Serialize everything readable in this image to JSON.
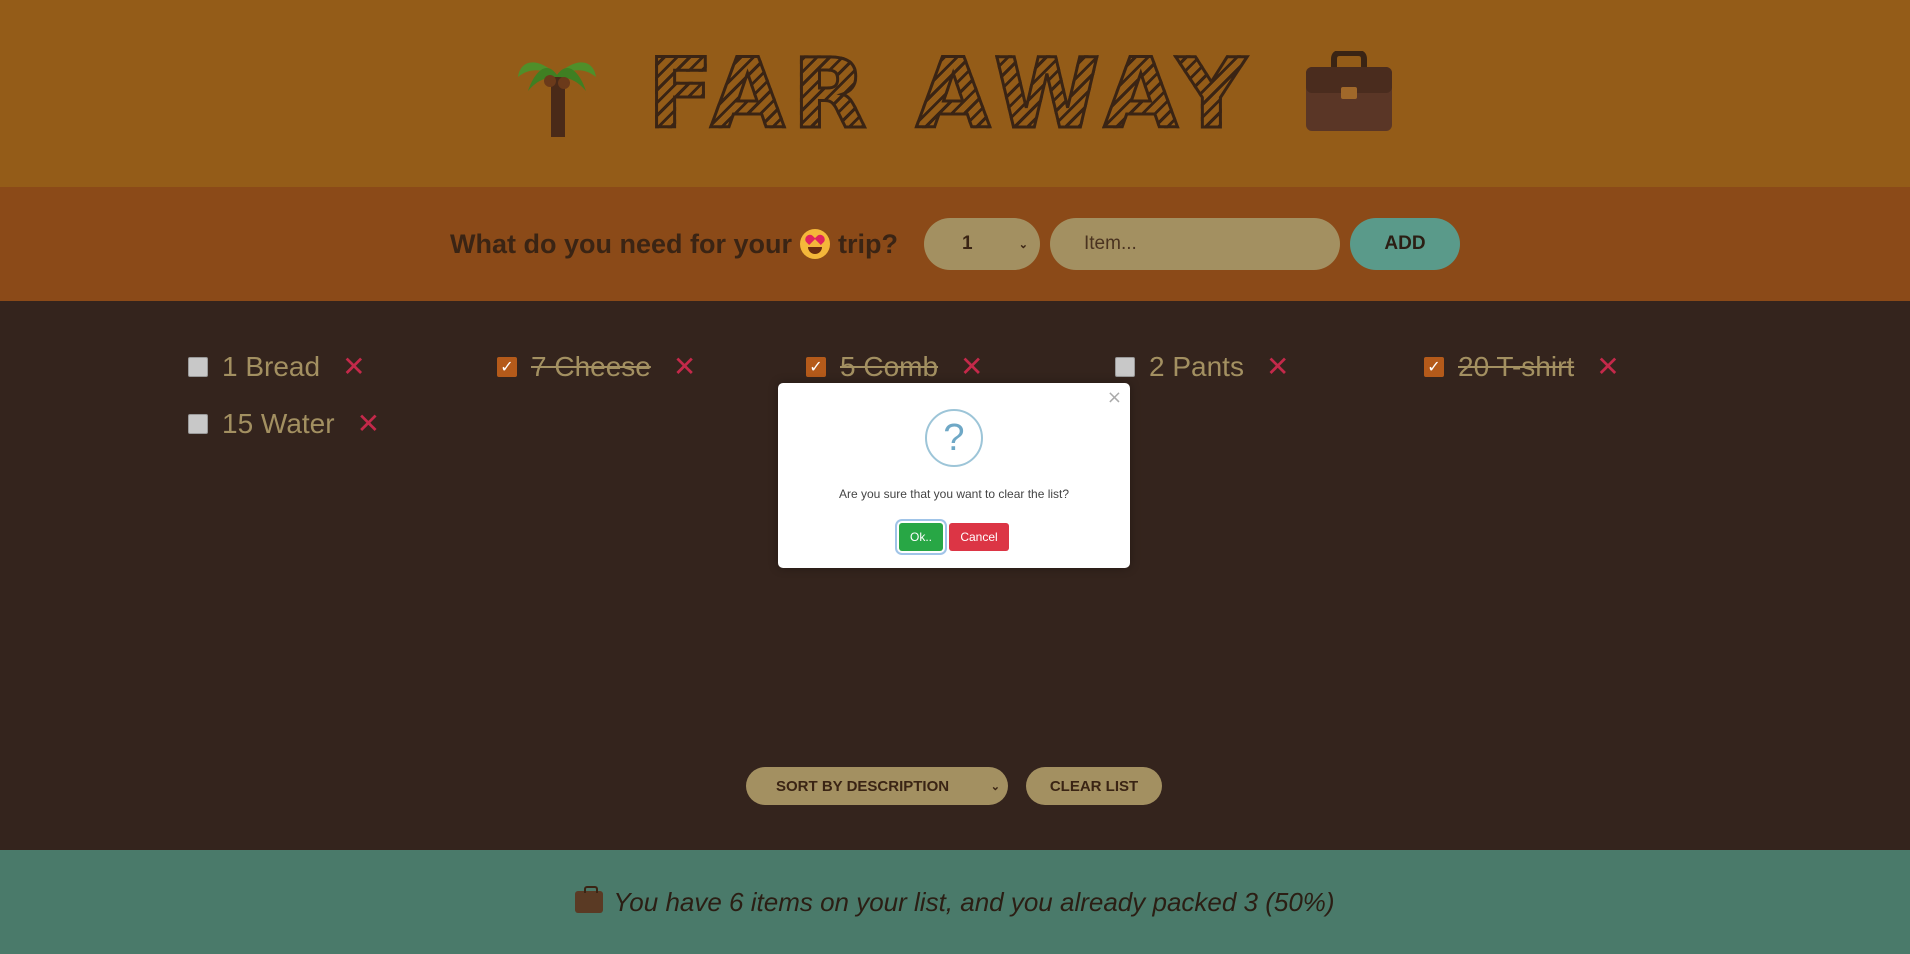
{
  "header": {
    "title": "FAR AWAY",
    "left_icon": "palm-tree-icon",
    "right_icon": "suitcase-icon"
  },
  "form": {
    "question_prefix": "What do you need for your",
    "question_emoji": "heart-eyes-emoji-icon",
    "question_suffix": "trip?",
    "quantity_value": "1",
    "item_placeholder": "Item...",
    "add_label": "ADD"
  },
  "items": [
    {
      "label": "1 Bread",
      "packed": false
    },
    {
      "label": "7 Cheese",
      "packed": true
    },
    {
      "label": "5 Comb",
      "packed": true
    },
    {
      "label": "2 Pants",
      "packed": false
    },
    {
      "label": "20 T-shirt",
      "packed": true
    },
    {
      "label": "15 Water",
      "packed": false
    }
  ],
  "actions": {
    "sort_value": "SORT BY DESCRIPTION",
    "clear_label": "CLEAR LIST"
  },
  "stats": {
    "text": "You have 6 items on your list, and you already packed 3 (50%)"
  },
  "modal": {
    "icon": "question-icon",
    "close": "×",
    "question_mark": "?",
    "message": "Are you sure that you want to clear the list?",
    "ok_label": "Ok..",
    "cancel_label": "Cancel"
  },
  "colors": {
    "header_bg": "#945c18",
    "form_bg": "#8b4a18",
    "list_bg": "#34241d",
    "stats_bg": "#4a7a6a",
    "delete": "#c4294a",
    "ok": "#28a745",
    "cancel": "#dc3545"
  }
}
